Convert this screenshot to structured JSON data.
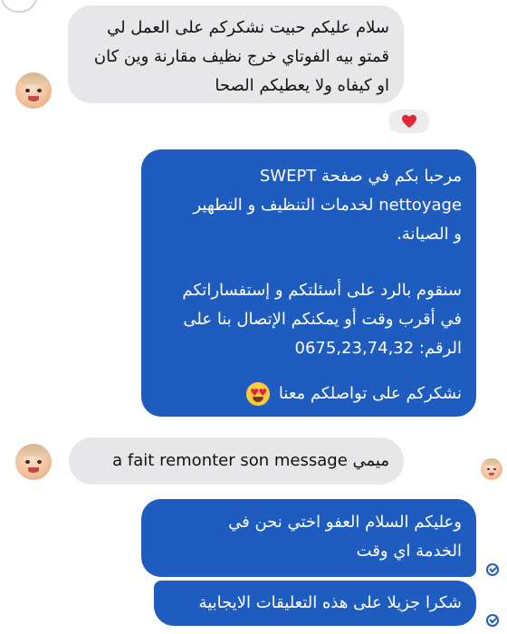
{
  "colors": {
    "outgoing_bubble": "#1f5cc0",
    "incoming_bubble": "#e7e7e9",
    "reaction": "#e5253a"
  },
  "messages": [
    {
      "lines": [
        "سلام عليكم حبيت  نشكركم على العمل لي",
        "قمتو بيه الفوتاي خرج  نظيف مقارنة وين كان",
        "او كيفاه ولا  يعطيكم الصحا"
      ],
      "reaction_icon": "red-heart-icon"
    },
    {
      "lines": [
        "مرحبا بكم في صفحة SWEPT",
        "nettoyage لخدمات التنظيف و التطهير",
        "و الصيانة.",
        "",
        "سنقوم بالرد على أسئلتكم و إستفساراتكم",
        "في أقرب وقت أو يمكنكم الإتصال بنا على",
        "الرقم: 0675,23,74,32",
        "",
        "نشكركم على تواصلكم معنا"
      ],
      "emoji_icon": "heart-eyes-emoji-icon"
    },
    {
      "text": "ميمي a fait remonter son message"
    },
    {
      "lines": [
        "وعليكم السلام العفو اختي نحن في",
        "الخدمة اي وقت"
      ]
    },
    {
      "text": "شكرا جزيلا على هذه التعليقات الايجابية"
    }
  ]
}
